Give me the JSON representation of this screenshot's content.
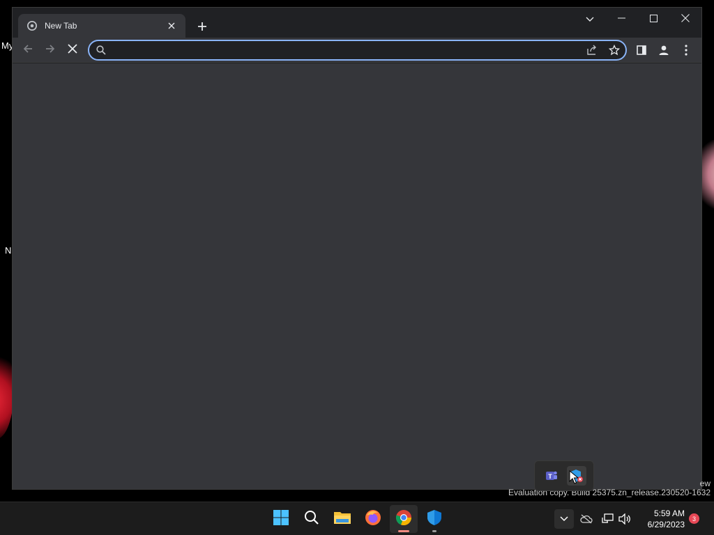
{
  "desktop": {
    "left_labels": [
      "My",
      "N"
    ]
  },
  "browser": {
    "tab": {
      "title": "New Tab"
    },
    "omnibox": {
      "value": "",
      "placeholder": ""
    },
    "colors": {
      "accent": "#8ab4f8",
      "frame": "#202124",
      "toolbar": "#35363a"
    },
    "icons": {
      "back": "arrow-left-icon",
      "forward": "arrow-right-icon",
      "stop": "stop-loading-icon",
      "share": "share-icon",
      "bookmark": "star-icon",
      "side_panel": "side-panel-icon",
      "profile": "profile-icon",
      "menu": "kebab-menu-icon"
    }
  },
  "tray_popup": {
    "icons": [
      "teams-icon",
      "defender-update-icon"
    ]
  },
  "watermark": {
    "partial": "ew",
    "text": "Evaluation copy. Build 25375.zn_release.230520-1632"
  },
  "taskbar": {
    "apps": [
      "start-icon",
      "search-icon",
      "file-explorer-icon",
      "firefox-icon",
      "chrome-icon",
      "windows-security-icon"
    ],
    "active_app": "chrome-icon",
    "clock": {
      "time": "5:59 AM",
      "date": "6/29/2023"
    },
    "notification_count": "3"
  }
}
